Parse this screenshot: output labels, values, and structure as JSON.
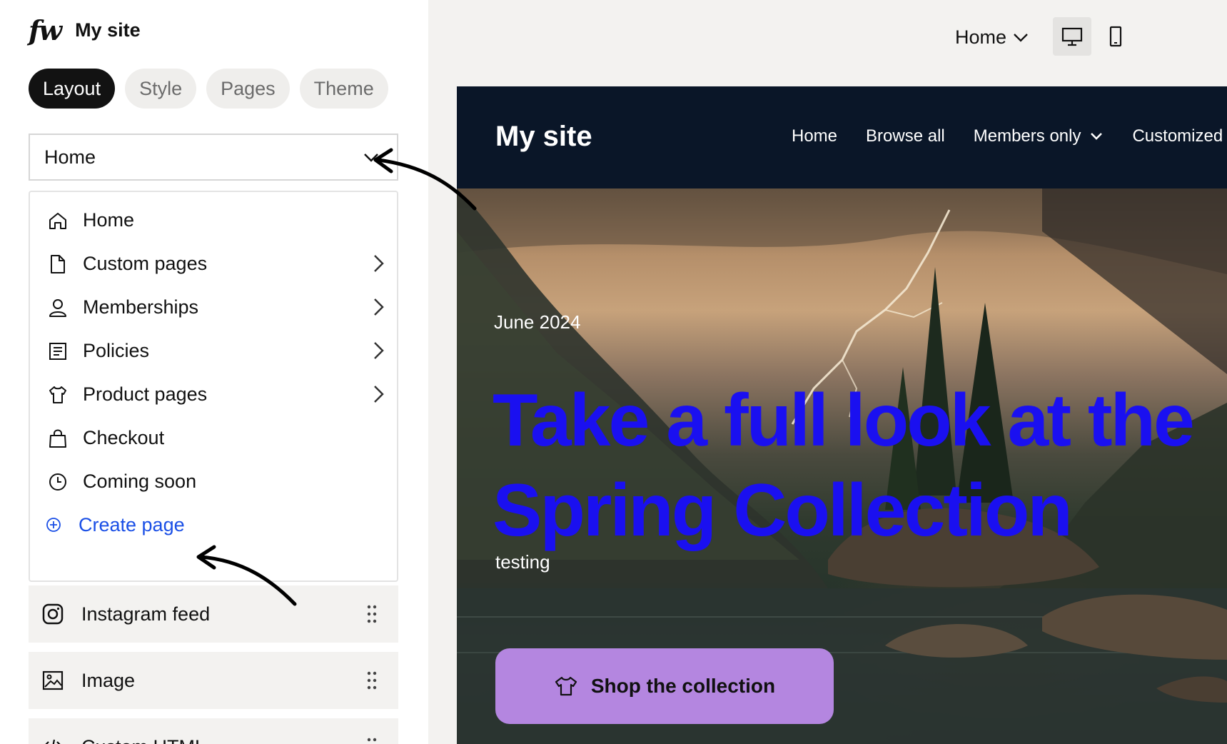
{
  "editor": {
    "logo": "fw",
    "site_name": "My site",
    "tabs": [
      {
        "label": "Layout",
        "active": true
      },
      {
        "label": "Style",
        "active": false
      },
      {
        "label": "Pages",
        "active": false
      },
      {
        "label": "Theme",
        "active": false
      }
    ],
    "page_select": "Home",
    "menu": {
      "items": [
        {
          "label": "Home",
          "icon": "home-icon",
          "submenu": false
        },
        {
          "label": "Custom pages",
          "icon": "document-icon",
          "submenu": true
        },
        {
          "label": "Memberships",
          "icon": "user-icon",
          "submenu": true
        },
        {
          "label": "Policies",
          "icon": "list-icon",
          "submenu": true
        },
        {
          "label": "Product pages",
          "icon": "shirt-icon",
          "submenu": true
        },
        {
          "label": "Checkout",
          "icon": "shopping-bag-icon",
          "submenu": false
        },
        {
          "label": "Coming soon",
          "icon": "clock-icon",
          "submenu": false
        }
      ],
      "create_label": "Create page"
    },
    "blocks": [
      {
        "label": "Instagram feed",
        "icon": "instagram-icon"
      },
      {
        "label": "Image",
        "icon": "image-icon"
      },
      {
        "label": "Custom HTML",
        "icon": "code-icon"
      }
    ]
  },
  "toolbar": {
    "preview_page": "Home",
    "device": "desktop"
  },
  "site": {
    "title": "My site",
    "nav": [
      "Home",
      "Browse all",
      "Members only",
      "Customized"
    ],
    "hero": {
      "date": "June 2024",
      "title_line1": "Take a full look at the",
      "title_line2": "Spring Collection",
      "subtitle": "testing",
      "button": "Shop the collection"
    }
  },
  "colors": {
    "accent_blue": "#1a4fe6",
    "hero_title": "#1a10f0",
    "button_purple": "#b486e0",
    "site_header": "#0a1628"
  }
}
